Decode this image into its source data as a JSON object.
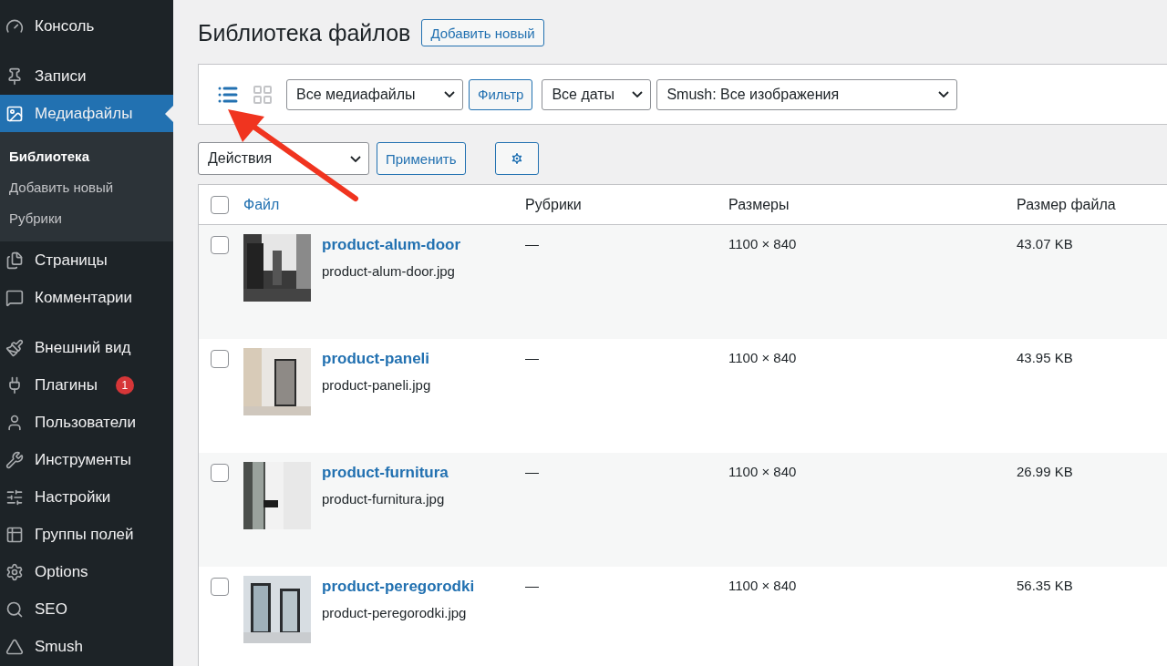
{
  "sidebar": {
    "groups": [
      {
        "items": [
          {
            "label": "Консоль",
            "selected": false
          }
        ]
      },
      {
        "items": [
          {
            "label": "Записи",
            "selected": false
          },
          {
            "label": "Медиафайлы",
            "selected": true,
            "children": [
              {
                "label": "Библиотека",
                "selected": true
              },
              {
                "label": "Добавить новый",
                "selected": false
              },
              {
                "label": "Рубрики",
                "selected": false
              }
            ]
          },
          {
            "label": "Страницы",
            "selected": false
          },
          {
            "label": "Комментарии",
            "selected": false
          }
        ]
      },
      {
        "items": [
          {
            "label": "Внешний вид",
            "selected": false
          },
          {
            "label": "Плагины",
            "selected": false,
            "badge": "1"
          },
          {
            "label": "Пользователи",
            "selected": false
          },
          {
            "label": "Инструменты",
            "selected": false
          },
          {
            "label": "Настройки",
            "selected": false
          },
          {
            "label": "Группы полей",
            "selected": false
          },
          {
            "label": "Options",
            "selected": false
          },
          {
            "label": "SEO",
            "selected": false
          },
          {
            "label": "Smush",
            "selected": false
          }
        ]
      }
    ]
  },
  "page": {
    "title": "Библиотека файлов",
    "add_button": "Добавить новый"
  },
  "filter_bar": {
    "view_modes": [
      {
        "selected": true
      },
      {
        "selected": false
      }
    ],
    "type_select": "Все медиафайлы",
    "filter_button": "Фильтр",
    "date_select": "Все даты",
    "smush_select": "Smush: Все изображения"
  },
  "bulk_actions": {
    "select": "Действия",
    "apply_button": "Применить"
  },
  "table": {
    "select_all": {
      "checked": false
    },
    "columns": [
      "Файл",
      "Рубрики",
      "Размеры",
      "Размер файла"
    ],
    "rows": [
      {
        "checked": false,
        "title": "product-alum-door",
        "filename": "product-alum-door.jpg",
        "categories": "—",
        "dimensions": "1100 × 840",
        "size": "43.07 KB"
      },
      {
        "checked": false,
        "title": "product-paneli",
        "filename": "product-paneli.jpg",
        "categories": "—",
        "dimensions": "1100 × 840",
        "size": "43.95 KB"
      },
      {
        "checked": false,
        "title": "product-furnitura",
        "filename": "product-furnitura.jpg",
        "categories": "—",
        "dimensions": "1100 × 840",
        "size": "26.99 KB"
      },
      {
        "checked": false,
        "title": "product-peregorodki",
        "filename": "product-peregorodki.jpg",
        "categories": "—",
        "dimensions": "1100 × 840",
        "size": "56.35 KB"
      }
    ]
  }
}
